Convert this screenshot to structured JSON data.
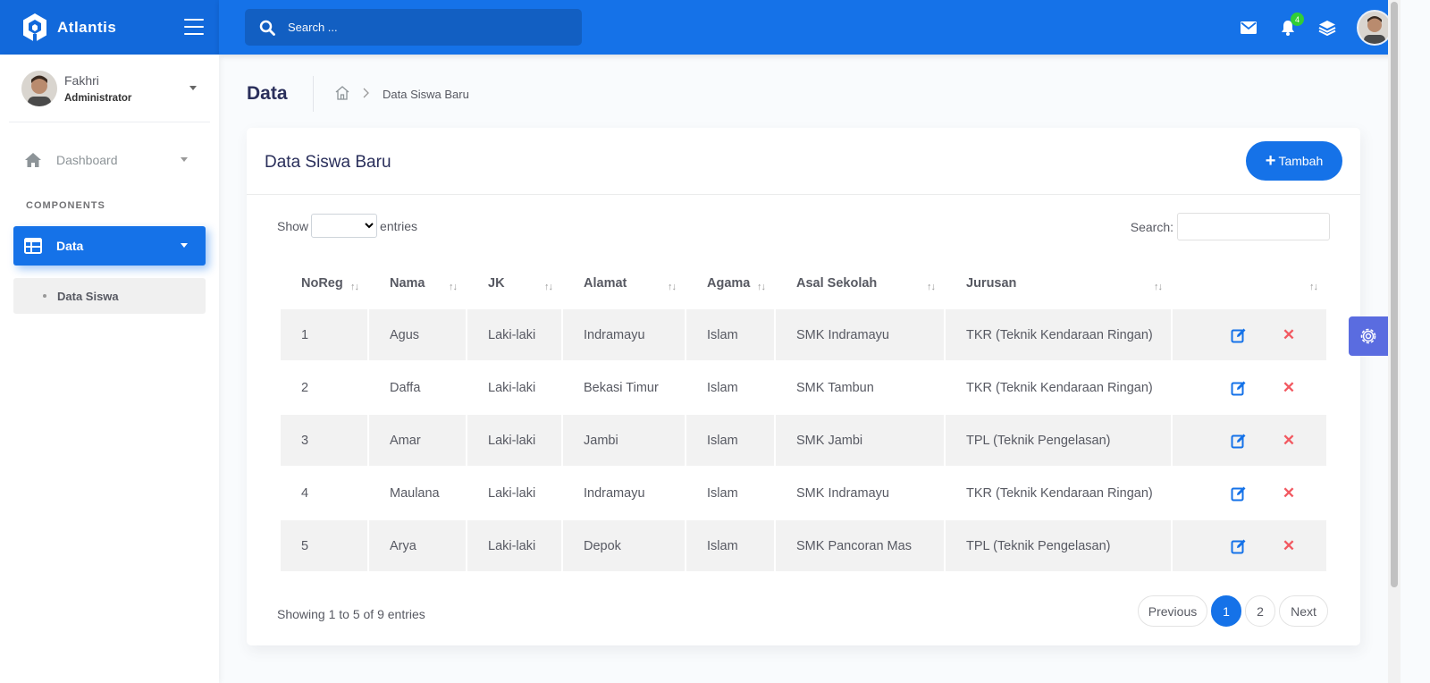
{
  "app": {
    "name": "Atlantis"
  },
  "colors": {
    "primary": "#1572e8",
    "header_dark": "#1269db",
    "danger": "#f25961",
    "success_badge": "#31ce36"
  },
  "topbar": {
    "search_placeholder": "Search ...",
    "icons": [
      "mail-icon",
      "bell-icon",
      "layers-icon"
    ],
    "notification_count": "4"
  },
  "user": {
    "name": "Fakhri",
    "role": "Administrator"
  },
  "sidebar": {
    "dashboard_label": "Dashboard",
    "section_title": "COMPONENTS",
    "data_label": "Data",
    "sub_item_label": "Data Siswa"
  },
  "page": {
    "title": "Data",
    "breadcrumb": "Data Siswa Baru"
  },
  "card": {
    "title": "Data Siswa Baru",
    "add_button": "Tambah",
    "show_label": "Show",
    "entries_label": "entries",
    "search_label": "Search:",
    "info": "Showing 1 to 5 of 9 entries"
  },
  "table": {
    "columns": [
      "NoReg",
      "Nama",
      "JK",
      "Alamat",
      "Agama",
      "Asal Sekolah",
      "Jurusan",
      ""
    ],
    "rows": [
      [
        "1",
        "Agus",
        "Laki-laki",
        "Indramayu",
        "Islam",
        "SMK Indramayu",
        "TKR (Teknik Kendaraan Ringan)"
      ],
      [
        "2",
        "Daffa",
        "Laki-laki",
        "Bekasi Timur",
        "Islam",
        "SMK Tambun",
        "TKR (Teknik Kendaraan Ringan)"
      ],
      [
        "3",
        "Amar",
        "Laki-laki",
        "Jambi",
        "Islam",
        "SMK Jambi",
        "TPL (Teknik Pengelasan)"
      ],
      [
        "4",
        "Maulana",
        "Laki-laki",
        "Indramayu",
        "Islam",
        "SMK Indramayu",
        "TKR (Teknik Kendaraan Ringan)"
      ],
      [
        "5",
        "Arya",
        "Laki-laki",
        "Depok",
        "Islam",
        "SMK Pancoran Mas",
        "TPL (Teknik Pengelasan)"
      ]
    ]
  },
  "pagination": {
    "previous": "Previous",
    "pages": [
      "1",
      "2"
    ],
    "active_page": "1",
    "next": "Next"
  }
}
